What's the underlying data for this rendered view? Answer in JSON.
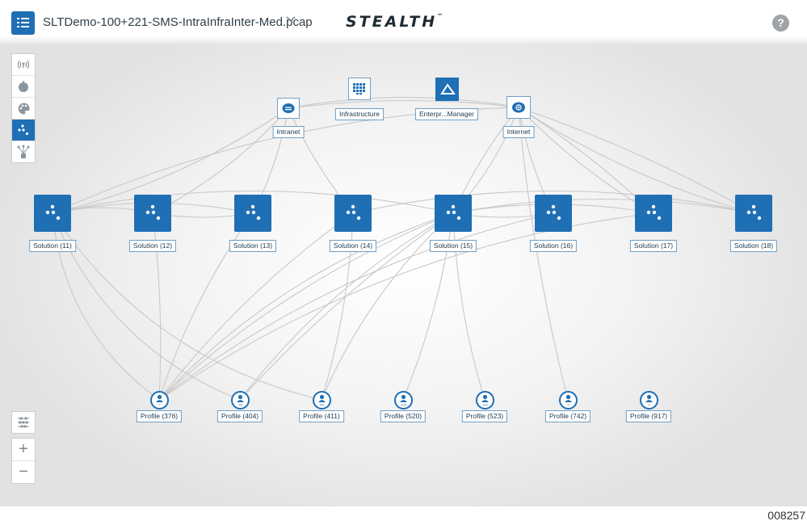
{
  "header": {
    "file_name": "SLTDemo-100+221-SMS-IntraInfraInter-Med.pcap",
    "logo_text": "STEALTH",
    "logo_tm": "™",
    "help_label": "?"
  },
  "toolbar": {
    "tools": [
      {
        "name": "broadcast-icon"
      },
      {
        "name": "node-icon"
      },
      {
        "name": "palette-icon"
      },
      {
        "name": "cluster-icon",
        "active": true
      },
      {
        "name": "hierarchy-icon"
      }
    ]
  },
  "services": [
    {
      "label": "Intranet",
      "icon": "cloud-icon"
    },
    {
      "label": "Infrastructure",
      "icon": "grid-icon"
    },
    {
      "label": "Enterpr...Manager",
      "icon": "triangle-icon"
    },
    {
      "label": "Internet",
      "icon": "globe-cloud-icon"
    }
  ],
  "solutions": [
    {
      "label": "Solution (11)"
    },
    {
      "label": "Solution (12)"
    },
    {
      "label": "Solution (13)"
    },
    {
      "label": "Solution (14)"
    },
    {
      "label": "Solution (15)"
    },
    {
      "label": "Solution (16)"
    },
    {
      "label": "Solution (17)"
    },
    {
      "label": "Solution (18)"
    }
  ],
  "profiles": [
    {
      "label": "Profile (376)",
      "badge": "7"
    },
    {
      "label": "Profile (404)",
      "badge": "36"
    },
    {
      "label": "Profile (411)",
      "badge": "83"
    },
    {
      "label": "Profile (520)",
      "badge": "109"
    },
    {
      "label": "Profile (523)",
      "badge": "112"
    },
    {
      "label": "Profile (742)",
      "badge": "2"
    },
    {
      "label": "Profile (917)",
      "badge": "1"
    }
  ],
  "zoom": {
    "in_label": "+",
    "out_label": "−"
  },
  "colors": {
    "accent": "#1f6fb5",
    "edge": "#c8c8c8",
    "label_border": "#6f9fc6"
  },
  "caption": "008257"
}
